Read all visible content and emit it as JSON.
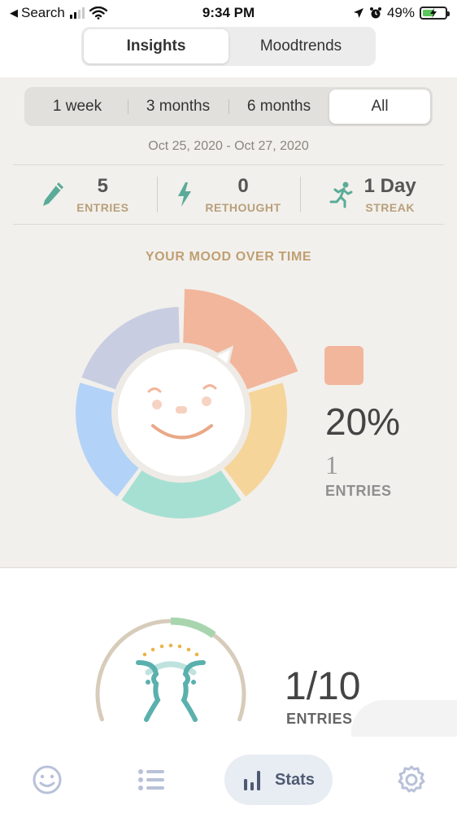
{
  "status_bar": {
    "back_label": "Search",
    "time": "9:34 PM",
    "battery": "49%"
  },
  "top_tabs": [
    {
      "label": "Insights",
      "active": true
    },
    {
      "label": "Moodtrends",
      "active": false
    }
  ],
  "range": {
    "options": [
      "1 week",
      "3 months",
      "6 months",
      "All"
    ],
    "selected": "All",
    "date_range": "Oct 25, 2020 - Oct 27, 2020"
  },
  "stats": {
    "entries": {
      "value": "5",
      "label": "ENTRIES",
      "icon": "pencil-icon"
    },
    "rethought": {
      "value": "0",
      "label": "RETHOUGHT",
      "icon": "lightning-icon"
    },
    "streak": {
      "value": "1 Day",
      "label": "STREAK",
      "icon": "running-icon"
    }
  },
  "mood": {
    "title": "YOUR MOOD OVER TIME",
    "selected_percent": "20%",
    "selected_count": "1",
    "selected_label": "ENTRIES",
    "selected_color": "#f2b69c"
  },
  "chart_data": {
    "type": "pie",
    "values": [
      20,
      20,
      20,
      20,
      20
    ],
    "colors": [
      "#f2b69c",
      "#f6d59b",
      "#a6e0d3",
      "#b3d2f7",
      "#c9cde2"
    ],
    "highlighted_index": 0
  },
  "goal": {
    "fraction": "1/10",
    "label": "ENTRIES",
    "progress": 0.1
  },
  "bottom_nav": {
    "items": [
      {
        "icon": "smiley-icon"
      },
      {
        "icon": "list-icon"
      },
      {
        "icon": "bar-chart-icon",
        "label": "Stats",
        "active": true
      },
      {
        "icon": "gear-icon"
      }
    ]
  },
  "colors": {
    "panel_bg": "#f2f0ec",
    "stat_label": "#b89f7a",
    "icon_teal": "#5aab98"
  }
}
